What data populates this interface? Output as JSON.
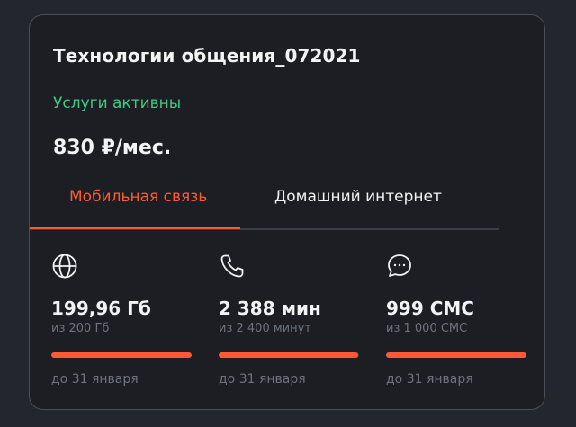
{
  "plan": {
    "title": "Технологии общения_072021",
    "status": "Услуги активны",
    "price": "830 ₽/мес."
  },
  "tabs": [
    {
      "label": "Мобильная связь",
      "active": true
    },
    {
      "label": "Домашний интернет",
      "active": false
    }
  ],
  "resources": [
    {
      "icon": "globe-icon",
      "value": "199,96 Гб",
      "limit": "из 200 Гб",
      "remaining_fraction": 0.9998,
      "until": "до 31 января"
    },
    {
      "icon": "phone-icon",
      "value": "2 388 мин",
      "limit": "из 2 400 минут",
      "remaining_fraction": 0.995,
      "until": "до 31 января"
    },
    {
      "icon": "chat-bubble-icon",
      "value": "999 СМС",
      "limit": "из 1 000 СМС",
      "remaining_fraction": 0.999,
      "until": "до 31 января"
    }
  ],
  "colors": {
    "accent": "#ff5a33",
    "status_active": "#41c981",
    "card_background": "#1c1e24",
    "page_background": "#24262d",
    "muted_text": "#6e727c"
  }
}
